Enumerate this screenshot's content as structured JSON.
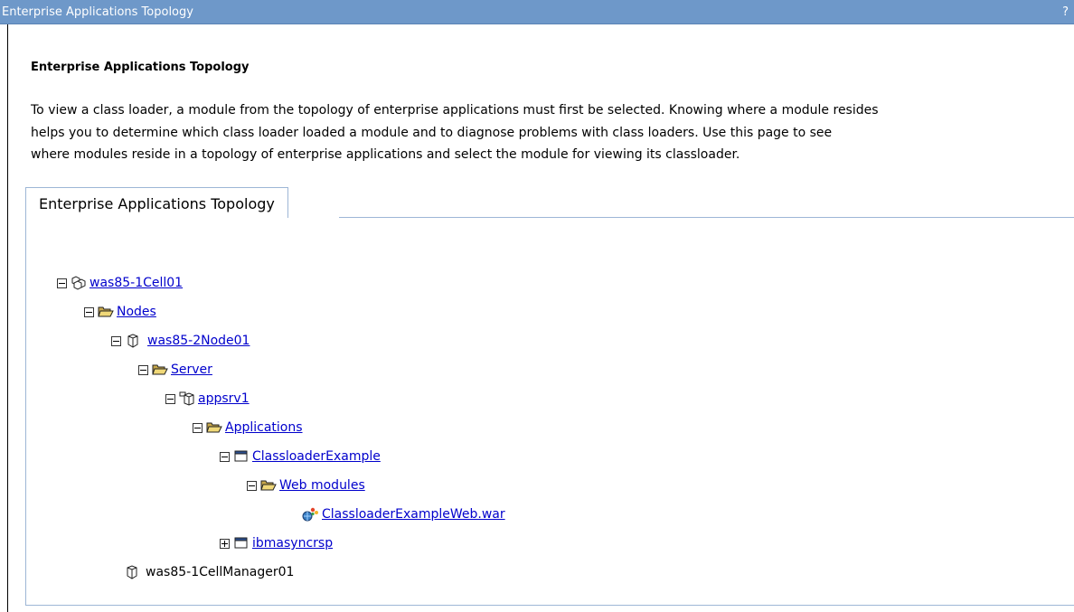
{
  "window": {
    "title": "Enterprise Applications Topology",
    "help": "?"
  },
  "page": {
    "heading": "Enterprise Applications Topology",
    "description": [
      "To view a class loader, a module from the topology of enterprise applications must first be selected. Knowing where a module resides",
      "helps you to determine which class loader loaded a module and to diagnose problems with class loaders. Use this page to see",
      "where modules reside in a topology of enterprise applications and select the module for viewing its classloader."
    ]
  },
  "tab": {
    "label": "Enterprise Applications Topology"
  },
  "tree": [
    {
      "label": "was85-1Cell01",
      "icon": "cell-icon",
      "toggle": "collapse",
      "link": true
    },
    {
      "label": "Nodes",
      "icon": "folder-open-icon",
      "toggle": "collapse",
      "link": true
    },
    {
      "label": "was85-2Node01",
      "icon": "node-icon",
      "toggle": "collapse",
      "link": true
    },
    {
      "label": "Server",
      "icon": "folder-open-icon",
      "toggle": "collapse",
      "link": true
    },
    {
      "label": "appsrv1",
      "icon": "server-icon",
      "toggle": "collapse",
      "link": true
    },
    {
      "label": "Applications",
      "icon": "folder-open-icon",
      "toggle": "collapse",
      "link": true
    },
    {
      "label": "ClassloaderExample",
      "icon": "application-icon",
      "toggle": "collapse",
      "link": true
    },
    {
      "label": "Web modules",
      "icon": "folder-open-icon",
      "toggle": "collapse",
      "link": true
    },
    {
      "label": "ClassloaderExampleWeb.war",
      "icon": "web-module-icon",
      "toggle": "none",
      "link": true
    },
    {
      "label": "ibmasyncrsp",
      "icon": "application-icon",
      "toggle": "expand",
      "link": true
    },
    {
      "label": "was85-1CellManager01",
      "icon": "node-icon",
      "toggle": "none",
      "link": false
    }
  ],
  "colors": {
    "titlebar": "#6e98c9",
    "link": "#0000cc",
    "border": "#9db6d6"
  }
}
